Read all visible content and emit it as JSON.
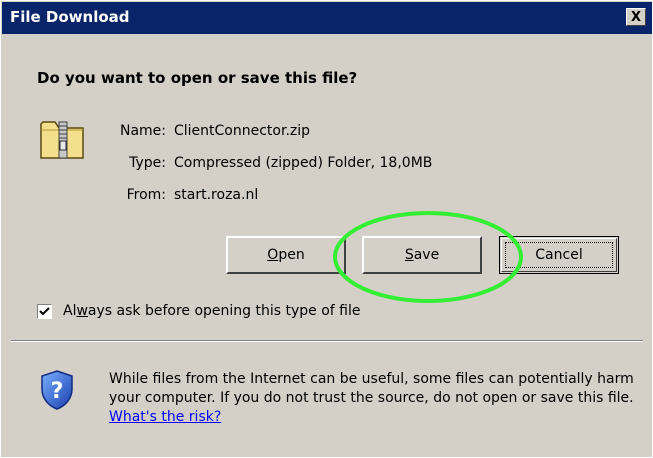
{
  "window": {
    "title": "File Download",
    "close_label": "X"
  },
  "dialog": {
    "question": "Do you want to open or save this file?",
    "file_icon": "zip-folder-icon",
    "info": {
      "name_label": "Name:",
      "name_value": "ClientConnector.zip",
      "type_label": "Type:",
      "type_value": "Compressed (zipped) Folder, 18,0MB",
      "from_label": "From:",
      "from_value": "start.roza.nl"
    },
    "buttons": {
      "open": {
        "accel": "O",
        "rest": "pen"
      },
      "save": {
        "accel": "S",
        "rest": "ave"
      },
      "cancel": "Cancel"
    },
    "checkbox": {
      "checked": true,
      "label_pre": "Al",
      "label_accel": "w",
      "label_post": "ays ask before opening this type of file"
    },
    "warning": {
      "icon": "shield-question-icon",
      "text": "While files from the Internet can be useful, some files can potentially harm your computer. If you do not trust the source, do not open or save this file.",
      "link": "What's the risk?"
    }
  },
  "annotation": {
    "shape": "ellipse",
    "color": "#33ee33",
    "target": "save-button"
  },
  "colors": {
    "titlebar": "#0a246a",
    "dialog_bg": "#d4d0c8",
    "link": "#0000ff"
  }
}
